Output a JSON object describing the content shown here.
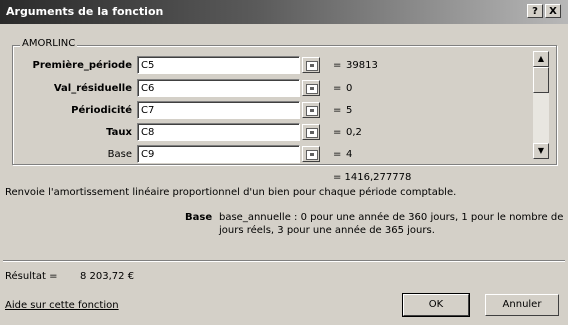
{
  "window": {
    "title": "Arguments de la fonction",
    "help_button": "?",
    "close_button": "X"
  },
  "function": {
    "name": "AMORLINC",
    "result_preview": "= 1416,277778",
    "description": "Renvoie l'amortissement linéaire proportionnel d'un bien pour chaque période comptable."
  },
  "arguments": [
    {
      "label": "Première_période",
      "value": "C5",
      "result": "39813",
      "required": true
    },
    {
      "label": "Val_résiduelle",
      "value": "C6",
      "result": "0",
      "required": true
    },
    {
      "label": "Périodicité",
      "value": "C7",
      "result": "5",
      "required": true
    },
    {
      "label": "Taux",
      "value": "C8",
      "result": "0,2",
      "required": true
    },
    {
      "label": "Base",
      "value": "C9",
      "result": "4",
      "required": false
    }
  ],
  "equals_sign": "=",
  "arg_help": {
    "name": "Base",
    "text_line1": "base_annuelle : 0 pour une année de 360 jours, 1 pour le nombre de",
    "text_line2": "jours réels, 3 pour une année de 365 jours."
  },
  "result": {
    "label": "Résultat =",
    "value": "8 203,72 €"
  },
  "footer": {
    "help_link": "Aide sur cette fonction",
    "ok_label": "OK",
    "cancel_label": "Annuler"
  },
  "scrollbar": {
    "up_glyph": "▲",
    "down_glyph": "▼"
  }
}
